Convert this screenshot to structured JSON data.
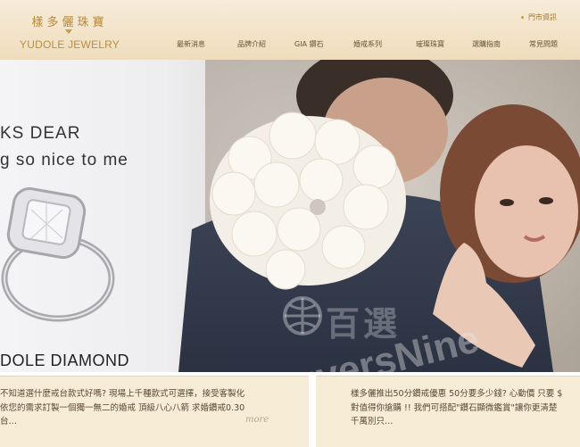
{
  "header": {
    "logo_cn": "樣多儷珠寶",
    "logo_en": "YUDOLE JEWELRY",
    "store_link": "門市資訊",
    "nav": [
      {
        "label": "最新消息"
      },
      {
        "label": "品牌介紹"
      },
      {
        "label": "GIA 鑽石"
      },
      {
        "label": "婚戒系列"
      },
      {
        "label": "璀璨珠寶"
      },
      {
        "label": "選購指南"
      },
      {
        "label": "常見問題"
      }
    ]
  },
  "hero": {
    "line1": "KS DEAR",
    "line2": "g so nice to me",
    "line3": "DOLE DIAMOND",
    "watermark_cn": "百選",
    "watermark_en": "BuyersNine"
  },
  "cards": [
    {
      "lines": [
        "不知道選什麼戒台款式好嗎? 現場上千種款式可選擇，接受客製化",
        "依您的需求訂製一個獨一無二的婚戒 頂級八心八箭 求婚鑽戒0.30",
        "台…"
      ],
      "more": "more"
    },
    {
      "lines": [
        "樣多儷推出50分鑽戒優惠 50分要多少錢? 心動價 只要 $",
        "對值得你搶購 !! 我們可搭配\"鑽石顯微鑑賞\"讓你更清楚",
        "千萬別只…"
      ]
    }
  ],
  "colors": {
    "header_bg": "#f2e3c9",
    "gold": "#b88a3a",
    "card_bg": "#f7ecd6"
  }
}
